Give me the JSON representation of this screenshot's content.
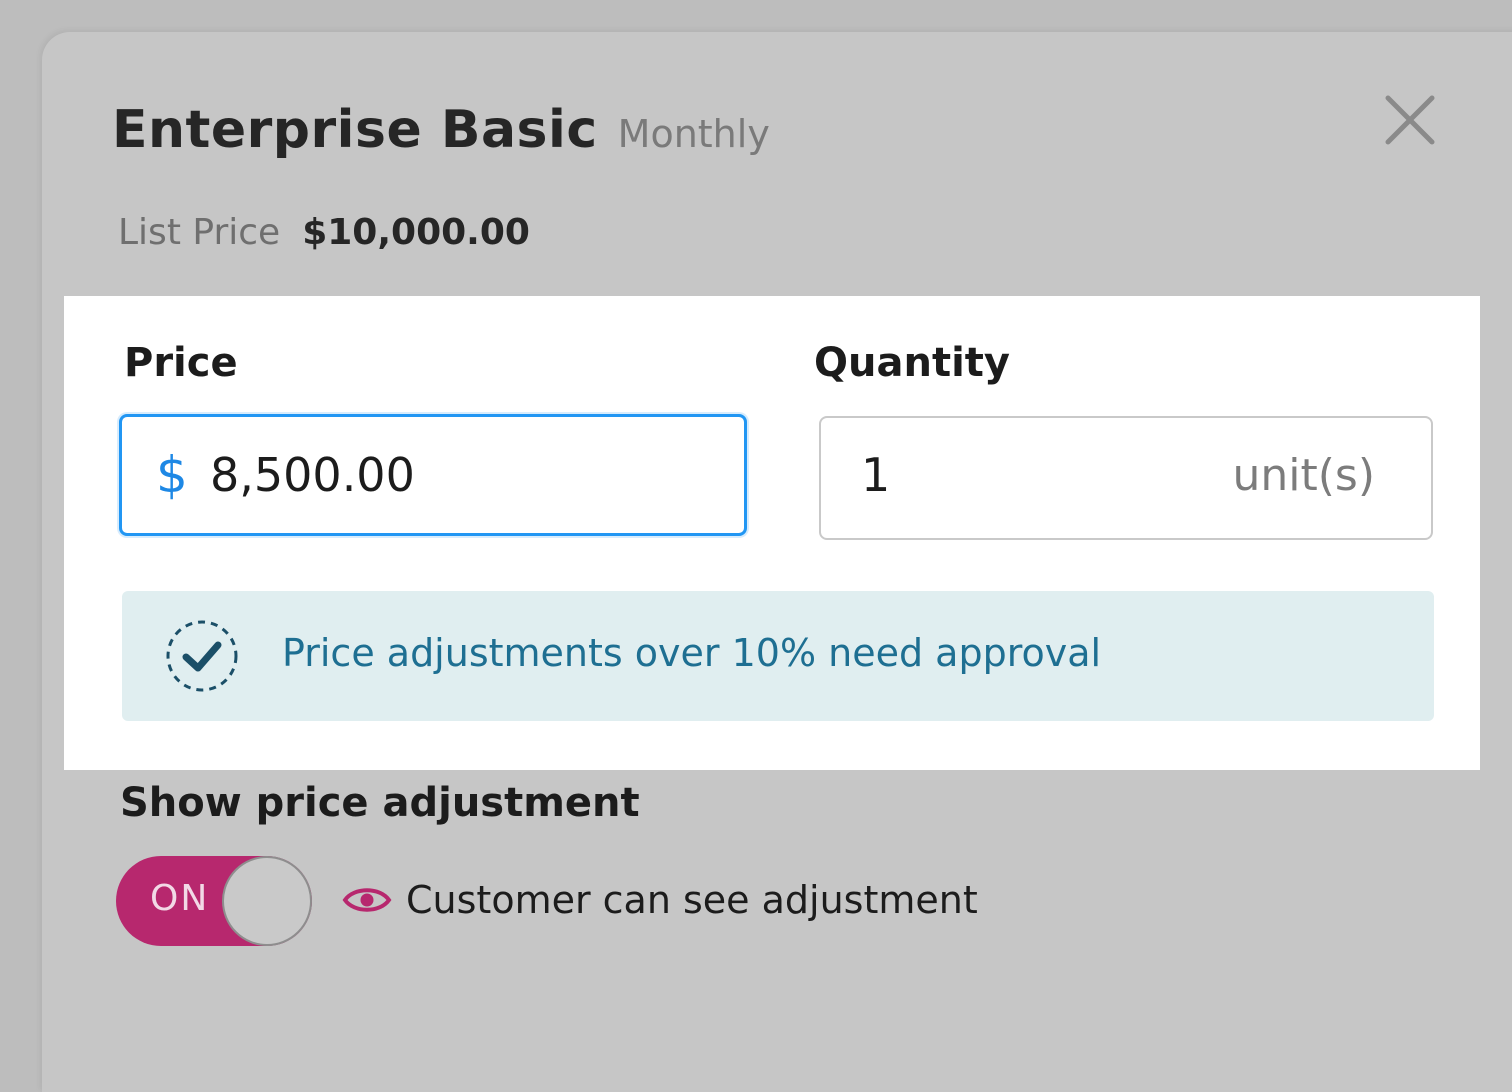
{
  "header": {
    "product_name": "Enterprise Basic",
    "billing_period": "Monthly",
    "close_icon": "close-icon"
  },
  "list_price": {
    "label": "List Price",
    "value": "$10,000.00"
  },
  "price_field": {
    "label": "Price",
    "currency_symbol": "$",
    "value": "8,500.00"
  },
  "quantity_field": {
    "label": "Quantity",
    "value": "1",
    "unit": "unit(s)"
  },
  "notice": {
    "icon": "check-circle-icon",
    "text": "Price adjustments over 10% need approval"
  },
  "adjustment": {
    "heading": "Show price adjustment",
    "toggle_state": "ON",
    "visibility_icon": "eye-icon",
    "visibility_text": "Customer can see adjustment"
  },
  "colors": {
    "accent_blue": "#2196f3",
    "toggle_on": "#b7286e",
    "notice_bg": "#e0eef0",
    "notice_text": "#1e6f92"
  }
}
